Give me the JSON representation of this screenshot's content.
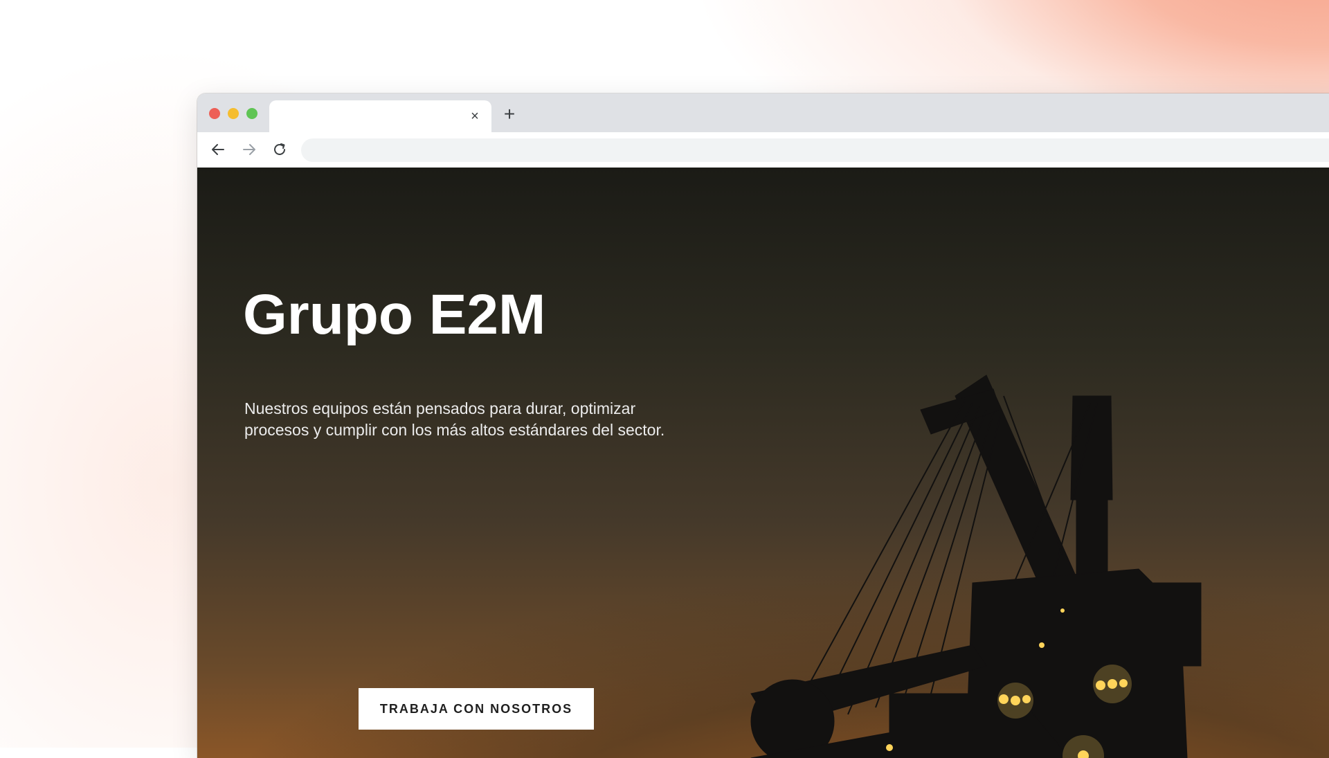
{
  "browser": {
    "tab_title": "",
    "tab_close_glyph": "×",
    "new_tab_glyph": "+",
    "address_value": "",
    "icons": [
      "back-arrow-icon",
      "forward-arrow-icon",
      "reload-icon",
      "close-icon",
      "plus-icon"
    ]
  },
  "hero": {
    "title": "Grupo E2M",
    "description": " Nuestros equipos están pensados para durar, optimizar procesos y cumplir con los más altos estándares del sector.",
    "cta_label": "TRABAJA CON NOSOTROS"
  },
  "colors": {
    "traffic_red": "#ed5f57",
    "traffic_yellow": "#f5bd2f",
    "traffic_green": "#5fc454",
    "cta_background": "#ffffff",
    "hero_light": "#ffd45a"
  }
}
